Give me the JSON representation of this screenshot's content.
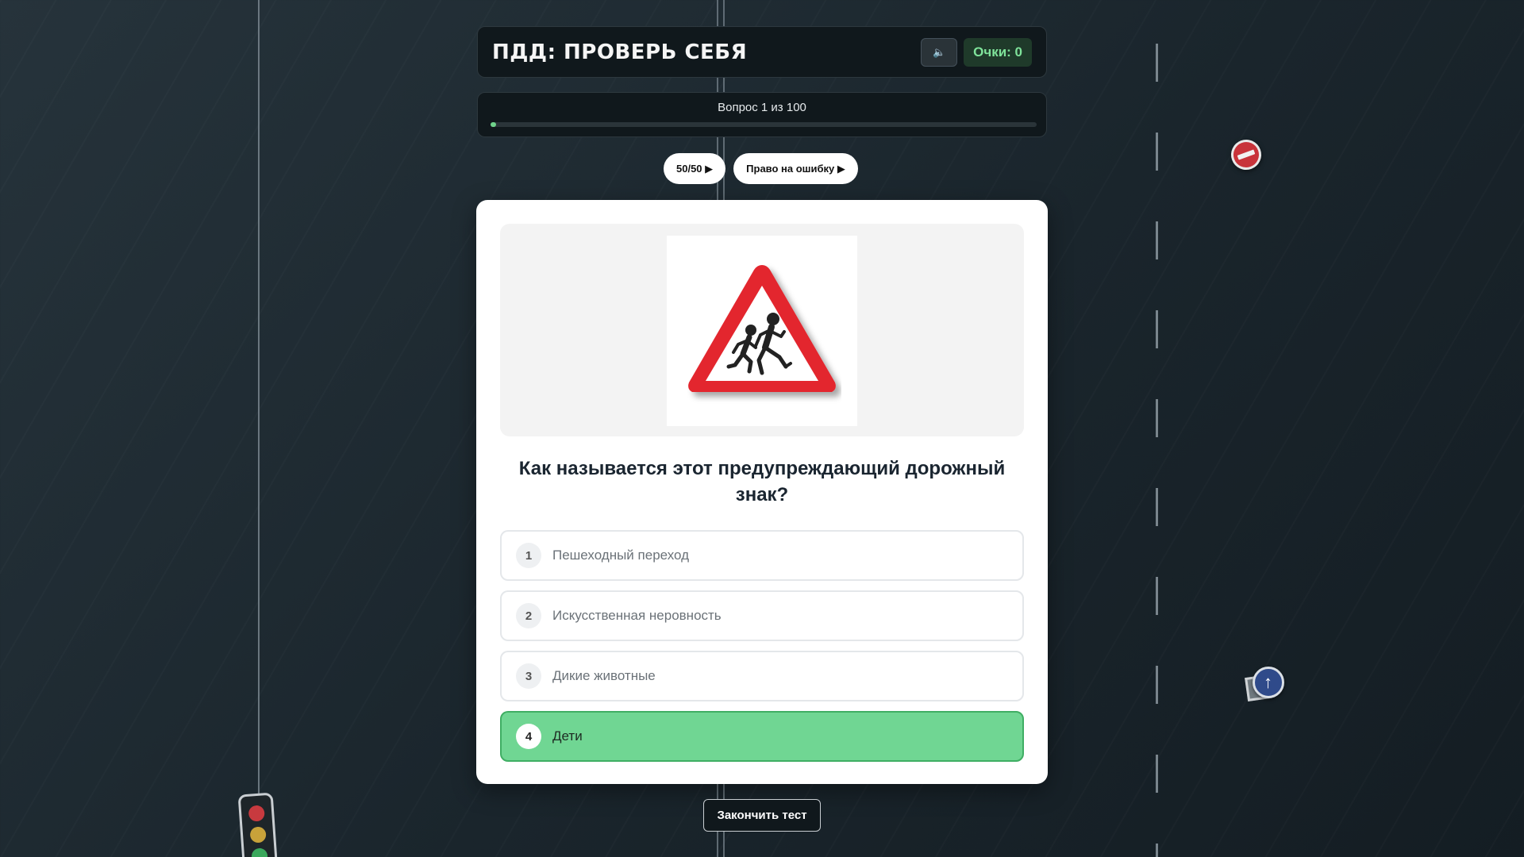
{
  "header": {
    "title": "ПДД: ПРОВЕРЬ СЕБЯ",
    "sound_icon": "🔈",
    "score_label": "Очки: 0"
  },
  "progress": {
    "label": "Вопрос 1 из 100",
    "fraction": 0.01
  },
  "lifelines": {
    "fifty": "50/50 ▶",
    "mistake": "Право на ошибку ▶"
  },
  "question": {
    "image_icon": "children-warning-sign",
    "text": "Как называется этот предупреждающий дорожный знак?"
  },
  "answers": [
    {
      "num": "1",
      "text": "Пешеходный переход",
      "selected": false
    },
    {
      "num": "2",
      "text": "Искусственная неровность",
      "selected": false
    },
    {
      "num": "3",
      "text": "Дикие животные",
      "selected": false
    },
    {
      "num": "4",
      "text": "Дети",
      "selected": true
    }
  ],
  "footer": {
    "finish_label": "Закончить тест"
  },
  "colors": {
    "accent_green": "#70d693",
    "sign_red": "#e3262f"
  }
}
